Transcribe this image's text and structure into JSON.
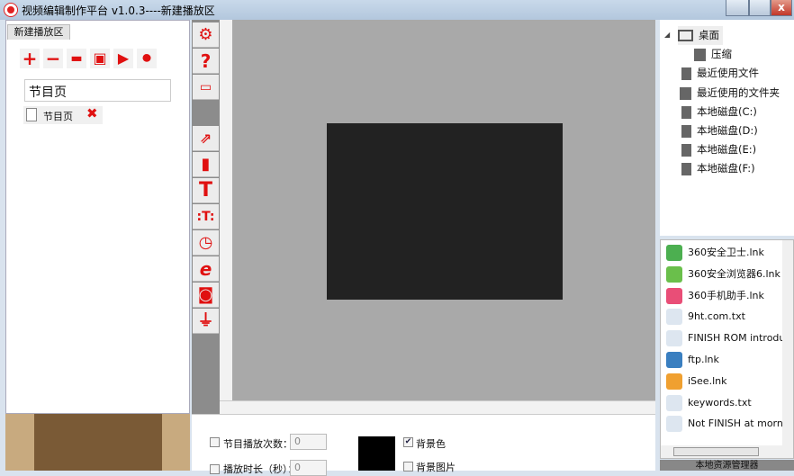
{
  "window": {
    "title": "视频编辑制作平台 v1.0.3----新建播放区",
    "close": "x"
  },
  "left": {
    "tab": "新建播放区",
    "page_name": "节目页",
    "pages": [
      {
        "label": "节目页"
      }
    ]
  },
  "toolbar_icons": [
    "plus-icon",
    "minus-icon",
    "folder-open-icon",
    "save-icon",
    "play-icon",
    "stop-icon"
  ],
  "tools": [
    "gear-icon",
    "help-icon",
    "window-icon",
    "export-icon",
    "page-icon",
    "text-icon",
    "text-frame-icon",
    "clock-icon",
    "browser-icon",
    "camera-icon",
    "plug-icon"
  ],
  "props": {
    "play_count_label": "节目播放次数：",
    "play_count": "0",
    "duration_label": "播放时长（秒）：",
    "duration": "0",
    "bg_color_label": "背景色",
    "bg_color_checked": true,
    "bg_image_label": "背景图片",
    "bg_image_checked": false,
    "bg_color": "#000000"
  },
  "tree": [
    {
      "label": "桌面",
      "icon": "monitor-icon"
    },
    {
      "label": "压缩",
      "icon": "folder-icon"
    },
    {
      "label": "最近使用文件",
      "icon": "file-icon"
    },
    {
      "label": "最近使用的文件夹",
      "icon": "folder-icon"
    },
    {
      "label": "本地磁盘(C:)",
      "icon": "disk-icon"
    },
    {
      "label": "本地磁盘(D:)",
      "icon": "disk-icon"
    },
    {
      "label": "本地磁盘(E:)",
      "icon": "disk-icon"
    },
    {
      "label": "本地磁盘(F:)",
      "icon": "disk-icon"
    }
  ],
  "files": [
    {
      "label": "360安全卫士.lnk",
      "color": "#4caf50"
    },
    {
      "label": "360安全浏览器6.lnk",
      "color": "#6abf4b"
    },
    {
      "label": "360手机助手.lnk",
      "color": "#e94e77"
    },
    {
      "label": "9ht.com.txt",
      "color": "#dde6f0"
    },
    {
      "label": "FINISH ROM introductio",
      "color": "#dde6f0"
    },
    {
      "label": "ftp.lnk",
      "color": "#3a7fc0"
    },
    {
      "label": "iSee.lnk",
      "color": "#f0a030"
    },
    {
      "label": "keywords.txt",
      "color": "#dde6f0"
    },
    {
      "label": "Not FINISH at morning.",
      "color": "#dde6f0"
    }
  ],
  "status": "本地资源管理器",
  "accent": "#e01010"
}
